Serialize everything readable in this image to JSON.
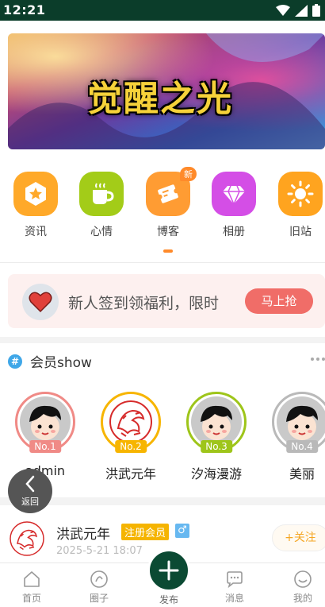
{
  "status_bar": {
    "time": "12:21"
  },
  "banner": {
    "title": "觉醒之光"
  },
  "shortcuts": [
    {
      "label": "资讯",
      "icon": "star-hexagon-icon",
      "color": "#ffa929"
    },
    {
      "label": "心情",
      "icon": "coffee-cup-icon",
      "color": "#a3cc18"
    },
    {
      "label": "博客",
      "icon": "ticket-icon",
      "color": "#ff9c33",
      "badge": "新"
    },
    {
      "label": "相册",
      "icon": "diamond-icon",
      "color": "#d44ee6"
    },
    {
      "label": "旧站",
      "icon": "sun-icon",
      "color": "#ffa41f"
    }
  ],
  "promo": {
    "text": "新人签到领福利，限时",
    "button": "马上抢"
  },
  "members": {
    "title": "会员show",
    "list": [
      {
        "name": "admin",
        "rank": "No.1",
        "ring_color": "#f08a86"
      },
      {
        "name": "洪武元年",
        "rank": "No.2",
        "ring_color": "#f7b500"
      },
      {
        "name": "汐海漫游",
        "rank": "No.3",
        "ring_color": "#9ec51a"
      },
      {
        "name": "美丽",
        "rank": "No.4",
        "ring_color": "#b9b9b9"
      }
    ]
  },
  "back_button": {
    "label": "返回"
  },
  "post": {
    "username": "洪武元年",
    "tag": "注册会员",
    "gender": "♂",
    "date": "2025-5-21 18:07",
    "follow": "+关注"
  },
  "tabbar": {
    "items": [
      {
        "label": "首页",
        "icon": "home-icon"
      },
      {
        "label": "圈子",
        "icon": "circle-icon"
      },
      {
        "label": "发布",
        "icon": "plus-icon"
      },
      {
        "label": "消息",
        "icon": "message-icon"
      },
      {
        "label": "我的",
        "icon": "smile-icon"
      }
    ]
  }
}
